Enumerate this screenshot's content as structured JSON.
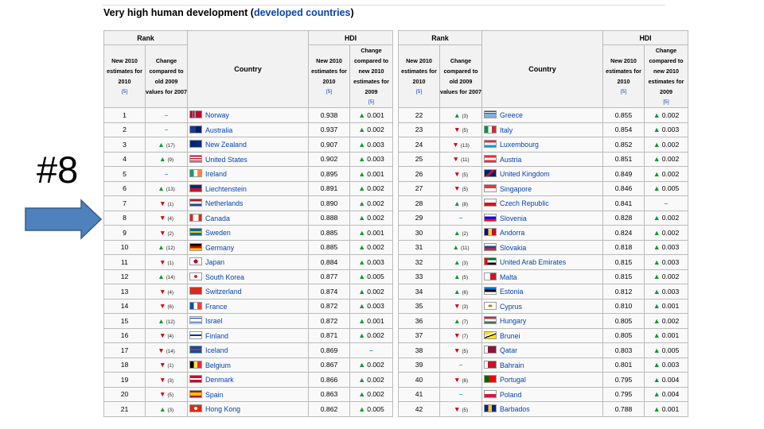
{
  "heading": {
    "prefix": "Very high human development (",
    "link": "developed countries",
    "suffix": ")"
  },
  "slide_label": "#8",
  "headers": {
    "rank": "Rank",
    "hdi": "HDI",
    "country": "Country",
    "new_estimates": "New 2010 estimates for 2010",
    "change_rank": "Change compared to old 2009 values for 2007",
    "new_hdi": "New 2010 estimates for 2010",
    "change_hdi": "Change compared to new 2010 estimates for 2009",
    "ref_rank": "[5]",
    "ref_hdi": "[5]",
    "ref_change": "[5]"
  },
  "colors": {
    "up": "#0b9a2a",
    "down": "#d40000",
    "same": "#3399ff",
    "link": "#0645ad",
    "arrow": "#4f81bd"
  },
  "left_rows": [
    {
      "rank": "1",
      "dir": "same",
      "n": "",
      "country": "Norway",
      "hdi": "0.938",
      "hdir": "up",
      "hval": "0.001"
    },
    {
      "rank": "2",
      "dir": "same",
      "n": "",
      "country": "Australia",
      "hdi": "0.937",
      "hdir": "up",
      "hval": "0.002"
    },
    {
      "rank": "3",
      "dir": "up",
      "n": "(17)",
      "country": "New Zealand",
      "hdi": "0.907",
      "hdir": "up",
      "hval": "0.003"
    },
    {
      "rank": "4",
      "dir": "up",
      "n": "(9)",
      "country": "United States",
      "hdi": "0.902",
      "hdir": "up",
      "hval": "0.003"
    },
    {
      "rank": "5",
      "dir": "same",
      "n": "",
      "country": "Ireland",
      "hdi": "0.895",
      "hdir": "up",
      "hval": "0.001"
    },
    {
      "rank": "6",
      "dir": "up",
      "n": "(13)",
      "country": "Liechtenstein",
      "hdi": "0.891",
      "hdir": "up",
      "hval": "0.002"
    },
    {
      "rank": "7",
      "dir": "down",
      "n": "(1)",
      "country": "Netherlands",
      "hdi": "0.890",
      "hdir": "up",
      "hval": "0.002"
    },
    {
      "rank": "8",
      "dir": "down",
      "n": "(4)",
      "country": "Canada",
      "hdi": "0.888",
      "hdir": "up",
      "hval": "0.002"
    },
    {
      "rank": "9",
      "dir": "down",
      "n": "(2)",
      "country": "Sweden",
      "hdi": "0.885",
      "hdir": "up",
      "hval": "0.001"
    },
    {
      "rank": "10",
      "dir": "up",
      "n": "(12)",
      "country": "Germany",
      "hdi": "0.885",
      "hdir": "up",
      "hval": "0.002"
    },
    {
      "rank": "11",
      "dir": "down",
      "n": "(1)",
      "country": "Japan",
      "hdi": "0.884",
      "hdir": "up",
      "hval": "0.003"
    },
    {
      "rank": "12",
      "dir": "up",
      "n": "(14)",
      "country": "South Korea",
      "hdi": "0.877",
      "hdir": "up",
      "hval": "0.005"
    },
    {
      "rank": "13",
      "dir": "down",
      "n": "(4)",
      "country": "Switzerland",
      "hdi": "0.874",
      "hdir": "up",
      "hval": "0.002"
    },
    {
      "rank": "14",
      "dir": "down",
      "n": "(6)",
      "country": "France",
      "hdi": "0.872",
      "hdir": "up",
      "hval": "0.003"
    },
    {
      "rank": "15",
      "dir": "up",
      "n": "(12)",
      "country": "Israel",
      "hdi": "0.872",
      "hdir": "up",
      "hval": "0.001"
    },
    {
      "rank": "16",
      "dir": "down",
      "n": "(4)",
      "country": "Finland",
      "hdi": "0.871",
      "hdir": "up",
      "hval": "0.002"
    },
    {
      "rank": "17",
      "dir": "down",
      "n": "(14)",
      "country": "Iceland",
      "hdi": "0.869",
      "hdir": "same",
      "hval": ""
    },
    {
      "rank": "18",
      "dir": "down",
      "n": "(1)",
      "country": "Belgium",
      "hdi": "0.867",
      "hdir": "up",
      "hval": "0.002"
    },
    {
      "rank": "19",
      "dir": "down",
      "n": "(3)",
      "country": "Denmark",
      "hdi": "0.866",
      "hdir": "up",
      "hval": "0.002"
    },
    {
      "rank": "20",
      "dir": "down",
      "n": "(5)",
      "country": "Spain",
      "hdi": "0.863",
      "hdir": "up",
      "hval": "0.002"
    },
    {
      "rank": "21",
      "dir": "up",
      "n": "(3)",
      "country": "Hong Kong",
      "hdi": "0.862",
      "hdir": "up",
      "hval": "0.005"
    }
  ],
  "right_rows": [
    {
      "rank": "22",
      "dir": "up",
      "n": "(3)",
      "country": "Greece",
      "hdi": "0.855",
      "hdir": "up",
      "hval": "0.002"
    },
    {
      "rank": "23",
      "dir": "down",
      "n": "(5)",
      "country": "Italy",
      "hdi": "0.854",
      "hdir": "up",
      "hval": "0.003"
    },
    {
      "rank": "24",
      "dir": "down",
      "n": "(13)",
      "country": "Luxembourg",
      "hdi": "0.852",
      "hdir": "up",
      "hval": "0.002"
    },
    {
      "rank": "25",
      "dir": "down",
      "n": "(11)",
      "country": "Austria",
      "hdi": "0.851",
      "hdir": "up",
      "hval": "0.002"
    },
    {
      "rank": "26",
      "dir": "down",
      "n": "(5)",
      "country": "United Kingdom",
      "hdi": "0.849",
      "hdir": "up",
      "hval": "0.002"
    },
    {
      "rank": "27",
      "dir": "down",
      "n": "(5)",
      "country": "Singapore",
      "hdi": "0.846",
      "hdir": "up",
      "hval": "0.005"
    },
    {
      "rank": "28",
      "dir": "up",
      "n": "(8)",
      "country": "Czech Republic",
      "hdi": "0.841",
      "hdir": "same",
      "hval": ""
    },
    {
      "rank": "29",
      "dir": "same",
      "n": "",
      "country": "Slovenia",
      "hdi": "0.828",
      "hdir": "up",
      "hval": "0.002"
    },
    {
      "rank": "30",
      "dir": "up",
      "n": "(2)",
      "country": "Andorra",
      "hdi": "0.824",
      "hdir": "up",
      "hval": "0.002"
    },
    {
      "rank": "31",
      "dir": "up",
      "n": "(11)",
      "country": "Slovakia",
      "hdi": "0.818",
      "hdir": "up",
      "hval": "0.003"
    },
    {
      "rank": "32",
      "dir": "up",
      "n": "(3)",
      "country": "United Arab Emirates",
      "hdi": "0.815",
      "hdir": "up",
      "hval": "0.003"
    },
    {
      "rank": "33",
      "dir": "up",
      "n": "(5)",
      "country": "Malta",
      "hdi": "0.815",
      "hdir": "up",
      "hval": "0.002"
    },
    {
      "rank": "34",
      "dir": "up",
      "n": "(6)",
      "country": "Estonia",
      "hdi": "0.812",
      "hdir": "up",
      "hval": "0.003"
    },
    {
      "rank": "35",
      "dir": "down",
      "n": "(3)",
      "country": "Cyprus",
      "hdi": "0.810",
      "hdir": "up",
      "hval": "0.001"
    },
    {
      "rank": "36",
      "dir": "up",
      "n": "(7)",
      "country": "Hungary",
      "hdi": "0.805",
      "hdir": "up",
      "hval": "0.002"
    },
    {
      "rank": "37",
      "dir": "down",
      "n": "(7)",
      "country": "Brunei",
      "hdi": "0.805",
      "hdir": "up",
      "hval": "0.001"
    },
    {
      "rank": "38",
      "dir": "down",
      "n": "(5)",
      "country": "Qatar",
      "hdi": "0.803",
      "hdir": "up",
      "hval": "0.005"
    },
    {
      "rank": "39",
      "dir": "same",
      "n": "",
      "country": "Bahrain",
      "hdi": "0.801",
      "hdir": "up",
      "hval": "0.003"
    },
    {
      "rank": "40",
      "dir": "down",
      "n": "(6)",
      "country": "Portugal",
      "hdi": "0.795",
      "hdir": "up",
      "hval": "0.004"
    },
    {
      "rank": "41",
      "dir": "same",
      "n": "",
      "country": "Poland",
      "hdi": "0.795",
      "hdir": "up",
      "hval": "0.004"
    },
    {
      "rank": "42",
      "dir": "down",
      "n": "(5)",
      "country": "Barbados",
      "hdi": "0.788",
      "hdir": "up",
      "hval": "0.001"
    }
  ],
  "flags": {
    "Norway": "linear-gradient(90deg,#ba0c2f 25%,#fff 25%,#fff 30%,#00205b 30%,#00205b 40%,#fff 40%,#fff 45%,#ba0c2f 45%)",
    "Australia": "linear-gradient(90deg,#1e3a8a 50%,#012169 50%)",
    "New Zealand": "linear-gradient(90deg,#00247d 50%,#0a2a7a 50%)",
    "United States": "repeating-linear-gradient(180deg,#b22234 0 1.5px,#fff 1.5px 3px)",
    "Ireland": "linear-gradient(90deg,#169b62 33%,#fff 33%,#fff 66%,#ff883e 66%)",
    "Liechtenstein": "linear-gradient(180deg,#002b7f 50%,#ce1126 50%)",
    "Netherlands": "linear-gradient(180deg,#ae1c28 33%,#fff 33%,#fff 66%,#21468b 66%)",
    "Canada": "linear-gradient(90deg,#d52b1e 25%,#fff 25%,#fff 75%,#d52b1e 75%)",
    "Sweden": "linear-gradient(180deg,#006aa7 40%,#fecc00 40%,#fecc00 60%,#006aa7 60%)",
    "Germany": "linear-gradient(180deg,#000 33%,#dd0000 33%,#dd0000 66%,#ffce00 66%)",
    "Japan": "radial-gradient(circle,#bc002d 30%,#fff 32%)",
    "South Korea": "radial-gradient(circle,#cd2e3a 25%,#fff 27%)",
    "Switzerland": "linear-gradient(#d52b1e,#d52b1e)",
    "France": "linear-gradient(90deg,#0055a4 33%,#fff 33%,#fff 66%,#ef4135 66%)",
    "Israel": "linear-gradient(180deg,#fff 15%,#0038b8 15%,#0038b8 25%,#fff 25%,#fff 75%,#0038b8 75%,#0038b8 85%,#fff 85%)",
    "Finland": "linear-gradient(180deg,#fff 40%,#003580 40%,#003580 60%,#fff 60%)",
    "Iceland": "linear-gradient(180deg,#02529c 38%,#dc1e35 38%,#dc1e35 62%,#02529c 62%)",
    "Belgium": "linear-gradient(90deg,#000 33%,#fae042 33%,#fae042 66%,#ed2939 66%)",
    "Denmark": "linear-gradient(180deg,#c60c30 40%,#fff 40%,#fff 60%,#c60c30 60%)",
    "Spain": "linear-gradient(180deg,#aa151b 25%,#f1bf00 25%,#f1bf00 75%,#aa151b 75%)",
    "Hong Kong": "radial-gradient(circle,#fff 25%,#de2910 27%)",
    "Greece": "repeating-linear-gradient(180deg,#0d5eaf 0 1.1px,#fff 1.1px 2.2px)",
    "Italy": "linear-gradient(90deg,#009246 33%,#fff 33%,#fff 66%,#ce2b37 66%)",
    "Luxembourg": "linear-gradient(180deg,#ed2939 33%,#fff 33%,#fff 66%,#00a1de 66%)",
    "Austria": "linear-gradient(180deg,#ed2939 33%,#fff 33%,#fff 66%,#ed2939 66%)",
    "United Kingdom": "linear-gradient(135deg,#012169 40%,#c8102e 40%,#c8102e 60%,#012169 60%)",
    "Singapore": "linear-gradient(180deg,#ef3340 50%,#fff 50%)",
    "Czech Republic": "linear-gradient(180deg,#fff 50%,#d7141a 50%)",
    "Slovenia": "linear-gradient(180deg,#fff 33%,#0000ff 33%,#0000ff 66%,#ff0000 66%)",
    "Andorra": "linear-gradient(90deg,#10069f 33%,#fedf00 33%,#fedf00 66%,#d50032 66%)",
    "Slovakia": "linear-gradient(180deg,#fff 33%,#0b4ea2 33%,#0b4ea2 66%,#ee1c25 66%)",
    "United Arab Emirates": "linear-gradient(90deg,#ff0000 25%,transparent 25%),linear-gradient(180deg,#00732f 33%,#fff 33%,#fff 66%,#000 66%)",
    "Malta": "linear-gradient(90deg,#fff 50%,#cf142b 50%)",
    "Estonia": "linear-gradient(180deg,#0072ce 33%,#000 33%,#000 66%,#fff 66%)",
    "Cyprus": "radial-gradient(ellipse,#d57800 25%,#fff 28%)",
    "Hungary": "linear-gradient(180deg,#ce2939 33%,#fff 33%,#fff 66%,#477050 66%)",
    "Brunei": "linear-gradient(160deg,#f7e017 35%,#fff 35%,#fff 50%,#000 50%,#000 60%,#f7e017 60%)",
    "Qatar": "linear-gradient(90deg,#fff 28%,#8a1538 28%)",
    "Bahrain": "linear-gradient(90deg,#fff 28%,#ce1126 28%)",
    "Portugal": "linear-gradient(90deg,#006600 40%,#ff0000 40%)",
    "Poland": "linear-gradient(180deg,#fff 50%,#dc143c 50%)",
    "Barbados": "linear-gradient(90deg,#00267f 33%,#ffc726 33%,#ffc726 66%,#00267f 66%)"
  }
}
